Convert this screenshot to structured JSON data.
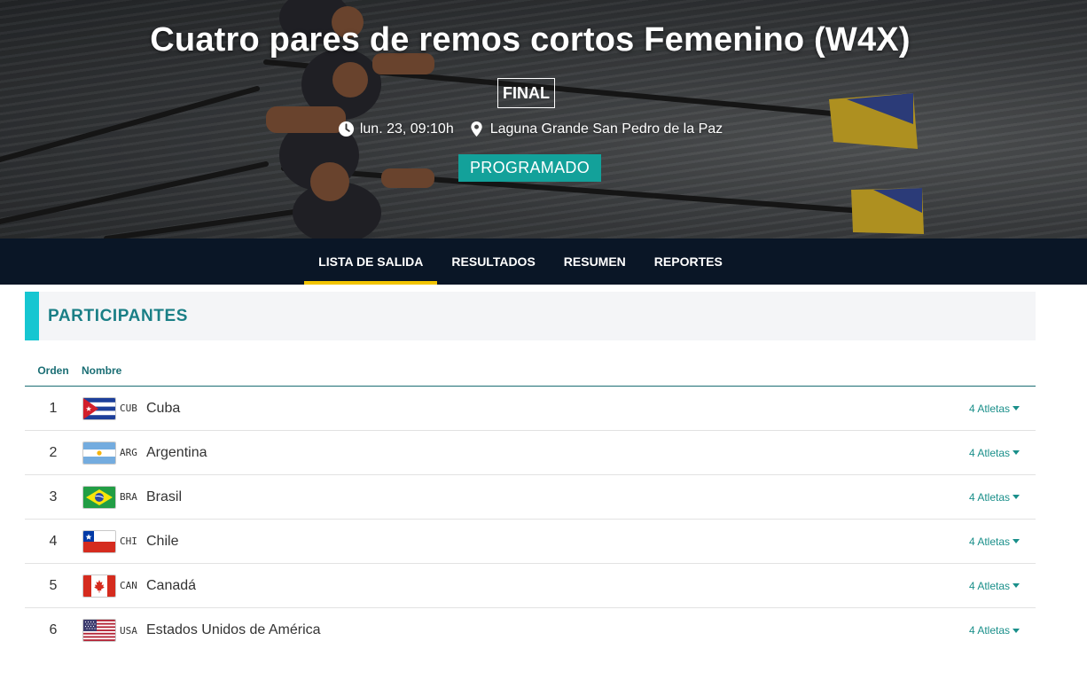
{
  "hero": {
    "title": "Cuatro pares de remos cortos Femenino (W4X)",
    "phase": "FINAL",
    "datetime": "lun. 23, 09:10h",
    "venue": "Laguna Grande San Pedro de la Paz",
    "status": "PROGRAMADO",
    "icons": {
      "time": "clock-icon",
      "venue": "location-pin-icon"
    }
  },
  "tabs": [
    {
      "label": "LISTA DE SALIDA",
      "active": true
    },
    {
      "label": "RESULTADOS",
      "active": false
    },
    {
      "label": "RESUMEN",
      "active": false
    },
    {
      "label": "REPORTES",
      "active": false
    }
  ],
  "section": {
    "title": "PARTICIPANTES"
  },
  "table": {
    "headers": {
      "order": "Orden",
      "name": "Nombre"
    },
    "rows": [
      {
        "order": "1",
        "code": "CUB",
        "country": "Cuba",
        "athletes": "4 Atletas",
        "flag": "cuba-flag-icon"
      },
      {
        "order": "2",
        "code": "ARG",
        "country": "Argentina",
        "athletes": "4 Atletas",
        "flag": "argentina-flag-icon"
      },
      {
        "order": "3",
        "code": "BRA",
        "country": "Brasil",
        "athletes": "4 Atletas",
        "flag": "brazil-flag-icon"
      },
      {
        "order": "4",
        "code": "CHI",
        "country": "Chile",
        "athletes": "4 Atletas",
        "flag": "chile-flag-icon"
      },
      {
        "order": "5",
        "code": "CAN",
        "country": "Canadá",
        "athletes": "4 Atletas",
        "flag": "canada-flag-icon"
      },
      {
        "order": "6",
        "code": "USA",
        "country": "Estados Unidos de América",
        "athletes": "4 Atletas",
        "flag": "usa-flag-icon"
      }
    ]
  },
  "colors": {
    "nav_bg": "#0a1626",
    "active_tab_underline": "#f2c400",
    "status_bg": "#13a19a",
    "section_accent": "#16c6d1",
    "section_title": "#1a7f86",
    "link": "#1a8f8a"
  }
}
